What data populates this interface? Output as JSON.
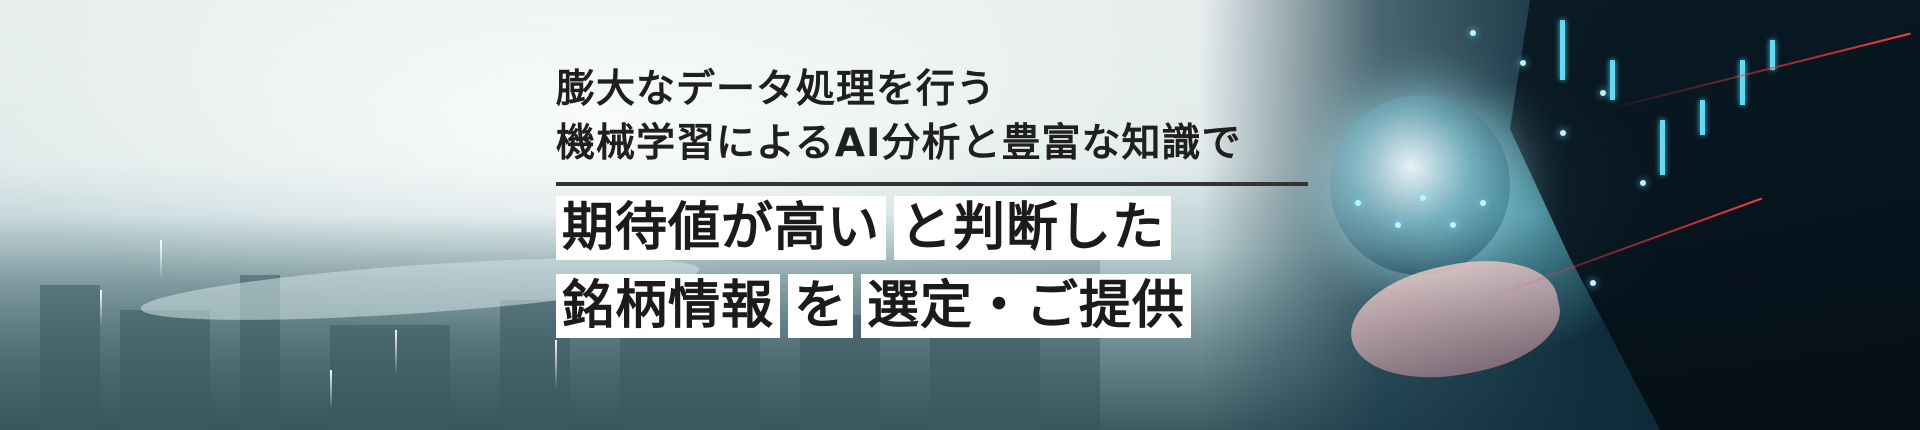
{
  "banner": {
    "headline_line1": "膨大なデータ処理を行う",
    "headline_line2": "機械学習によるAI分析と豊富な知識で",
    "line3_part1": "期待値が高い",
    "line3_part2": "と判断した",
    "line4_part1": "銘柄情報",
    "line4_part2": "を",
    "line4_part3": "選定・ご提供"
  },
  "colors": {
    "text": "#1f1f1f",
    "divider": "#333333",
    "highlight_bg": "#ffffff",
    "accent_cyan": "#69d7f0",
    "accent_red": "#ff3b3b"
  }
}
